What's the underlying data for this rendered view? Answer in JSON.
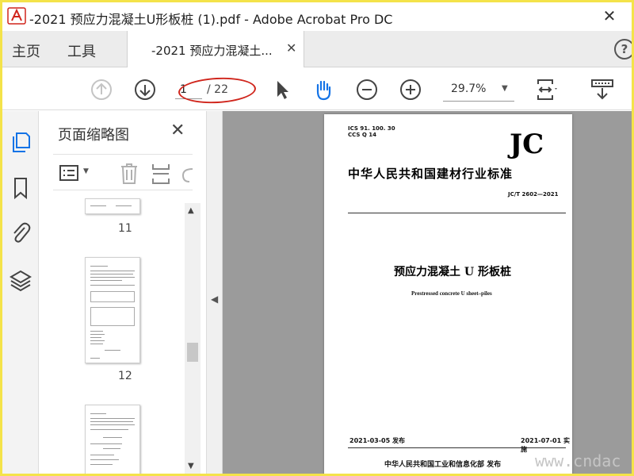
{
  "window": {
    "title": "-2021 预应力混凝土U形板桩 (1).pdf - Adobe Acrobat Pro DC",
    "close_symbol": "✕"
  },
  "tabs": {
    "home": "主页",
    "tools": "工具",
    "document_tab": "-2021 预应力混凝土...",
    "document_tab_close": "✕",
    "help": "?"
  },
  "toolbar": {
    "current_page": "1",
    "page_total": "/ 22",
    "zoom": "29.7%",
    "icons": [
      "prev-page-icon",
      "next-page-icon",
      "select-cursor-icon",
      "hand-tool-icon",
      "zoom-out-icon",
      "zoom-in-icon",
      "page-fit-icon",
      "read-mode-icon"
    ]
  },
  "rail": {
    "icons": [
      "pages-icon",
      "bookmark-icon",
      "attachment-icon",
      "layers-icon"
    ]
  },
  "thumb_panel": {
    "title": "页面缩略图",
    "close_symbol": "✕",
    "thumbnails": [
      {
        "label": "11"
      },
      {
        "label": "12"
      },
      {
        "label": ""
      }
    ]
  },
  "document_page": {
    "ics": "ICS 91. 100. 30",
    "ccs": "CCS Q 14",
    "jc_mark": "JC",
    "standard_title": "中华人民共和国建材行业标准",
    "code": "JC/T 2602—2021",
    "title_cn": "预应力混凝土 U 形板桩",
    "title_en": "Prestressed concrete U sheet–piles",
    "issue_date": "2021-03-05 发布",
    "impl_date": "2021-07-01 实施",
    "publisher": "中华人民共和国工业和信息化部   发布"
  },
  "watermark": {
    "text": "www.cndac"
  },
  "colors": {
    "accent_blue": "#1473e6",
    "annotation_red": "#d0251c",
    "doc_background": "#9b9b9b"
  }
}
